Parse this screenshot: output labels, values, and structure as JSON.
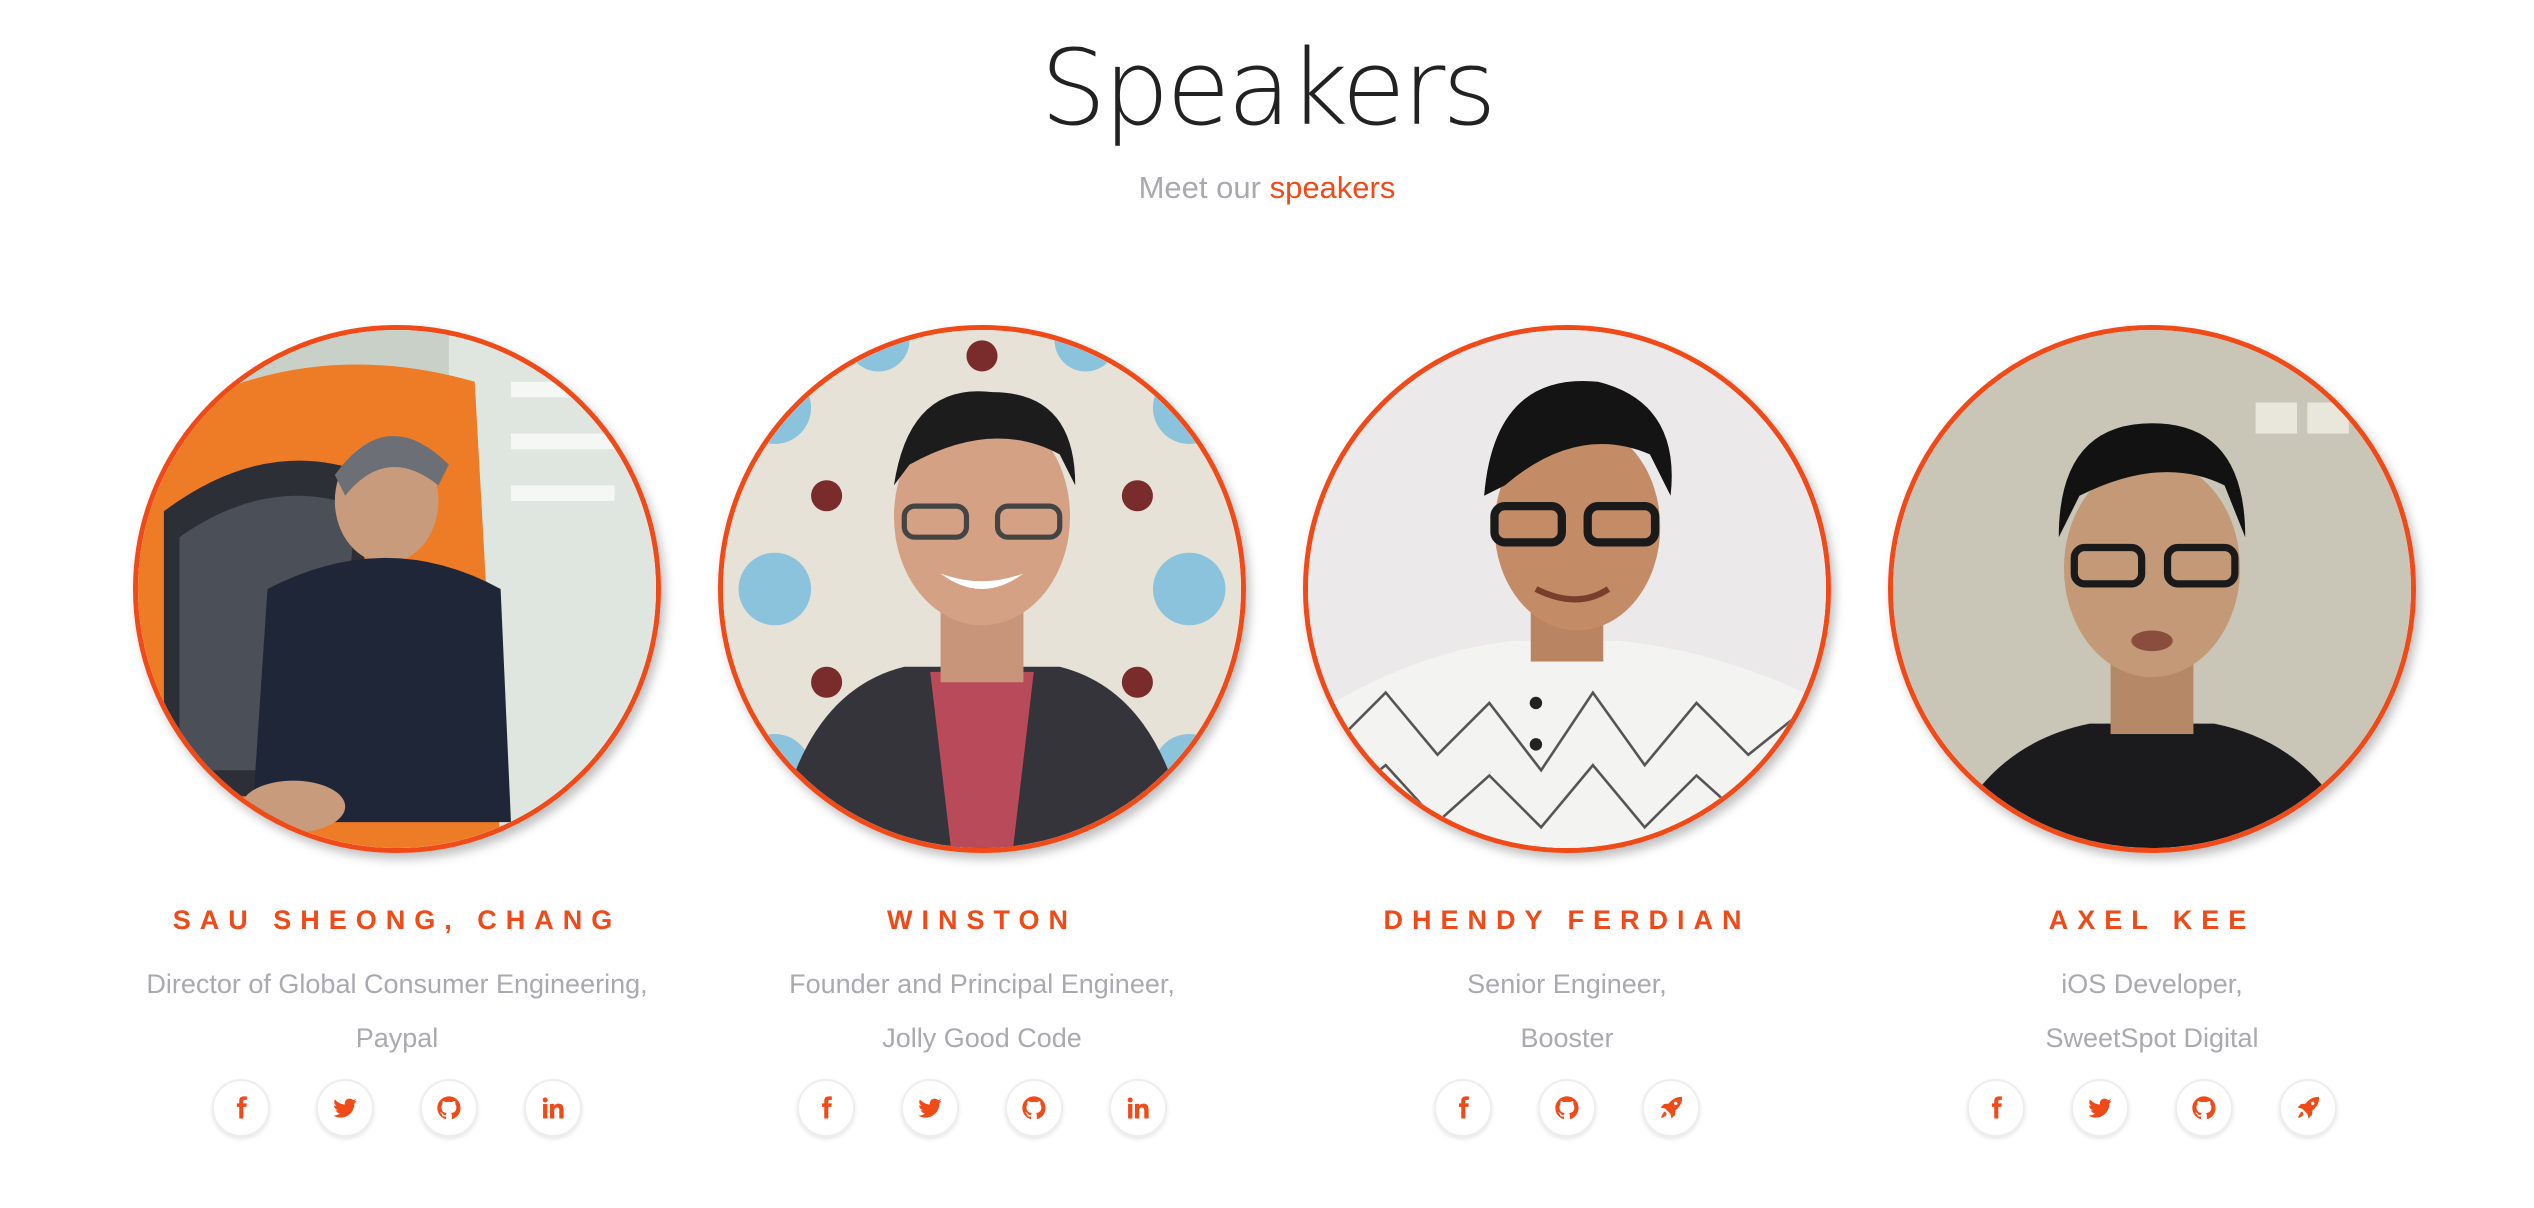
{
  "header": {
    "title": "Speakers",
    "subtitle_prefix": "Meet our",
    "subtitle_accent": "speakers"
  },
  "colors": {
    "accent": "#f04a18",
    "muted_text": "#a9a9b0",
    "heading": "#222222"
  },
  "speakers": [
    {
      "name": "SAU SHEONG, CHANG",
      "role_line1": "Director of Global Consumer Engineering,",
      "role_line2": "Paypal",
      "photo": "speaker-photo-sau-sheong",
      "socials": [
        "facebook-icon",
        "twitter-icon",
        "github-icon",
        "linkedin-icon"
      ]
    },
    {
      "name": "WINSTON",
      "role_line1": "Founder and Principal Engineer,",
      "role_line2": "Jolly Good Code",
      "photo": "speaker-photo-winston",
      "socials": [
        "facebook-icon",
        "twitter-icon",
        "github-icon",
        "linkedin-icon"
      ]
    },
    {
      "name": "DHENDY FERDIAN",
      "role_line1": "Senior Engineer,",
      "role_line2": "Booster",
      "photo": "speaker-photo-dhendy",
      "socials": [
        "facebook-icon",
        "github-icon",
        "rocket-icon"
      ]
    },
    {
      "name": "AXEL KEE",
      "role_line1": "iOS Developer,",
      "role_line2": "SweetSpot Digital",
      "photo": "speaker-photo-axel",
      "socials": [
        "facebook-icon",
        "twitter-icon",
        "github-icon",
        "rocket-icon"
      ]
    }
  ]
}
